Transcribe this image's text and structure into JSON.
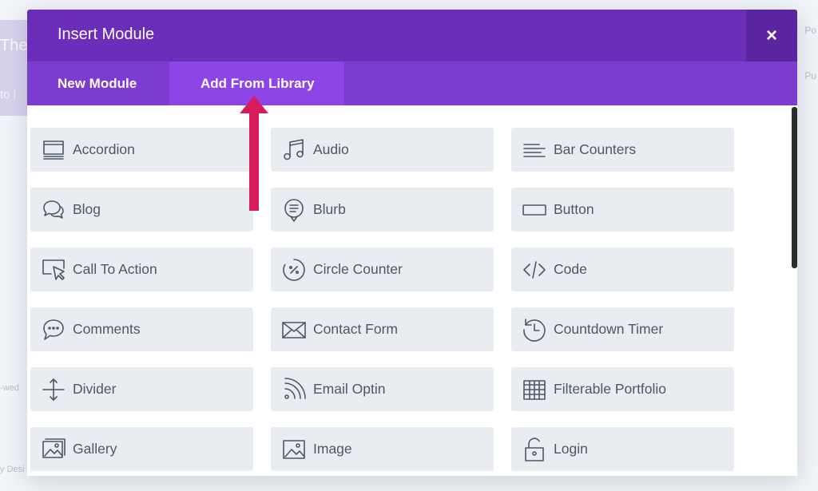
{
  "background": {
    "left_text_1": "The",
    "left_text_2": "to l",
    "left_small_1": "-wed",
    "left_small_2": "y Desi",
    "right_text_1": "Po",
    "right_text_2": "Pu"
  },
  "modal": {
    "title": "Insert Module",
    "close_label": "×",
    "tabs": [
      {
        "label": "New Module"
      },
      {
        "label": "Add From Library"
      }
    ],
    "modules": [
      {
        "label": "Accordion",
        "icon": "accordion-icon"
      },
      {
        "label": "Audio",
        "icon": "music-note-icon"
      },
      {
        "label": "Bar Counters",
        "icon": "bar-lines-icon"
      },
      {
        "label": "Blog",
        "icon": "chat-bubbles-icon"
      },
      {
        "label": "Blurb",
        "icon": "speech-bubble-lines-icon"
      },
      {
        "label": "Button",
        "icon": "button-rect-icon"
      },
      {
        "label": "Call To Action",
        "icon": "cursor-screen-icon"
      },
      {
        "label": "Circle Counter",
        "icon": "circle-percent-icon"
      },
      {
        "label": "Code",
        "icon": "code-brackets-icon"
      },
      {
        "label": "Comments",
        "icon": "comment-dots-icon"
      },
      {
        "label": "Contact Form",
        "icon": "envelope-icon"
      },
      {
        "label": "Countdown Timer",
        "icon": "clock-history-icon"
      },
      {
        "label": "Divider",
        "icon": "vertical-divider-icon"
      },
      {
        "label": "Email Optin",
        "icon": "rss-icon"
      },
      {
        "label": "Filterable Portfolio",
        "icon": "grid-table-icon"
      },
      {
        "label": "Gallery",
        "icon": "gallery-images-icon"
      },
      {
        "label": "Image",
        "icon": "image-icon"
      },
      {
        "label": "Login",
        "icon": "padlock-icon"
      }
    ]
  },
  "annotation": {
    "arrow_color": "#d81b5a"
  },
  "colors": {
    "header": "#6c2eb9",
    "tabs_bar": "#7e3bd0",
    "active_tab": "#8e45e6",
    "module_bg": "#e9ecf0",
    "module_text": "#4c5866"
  }
}
